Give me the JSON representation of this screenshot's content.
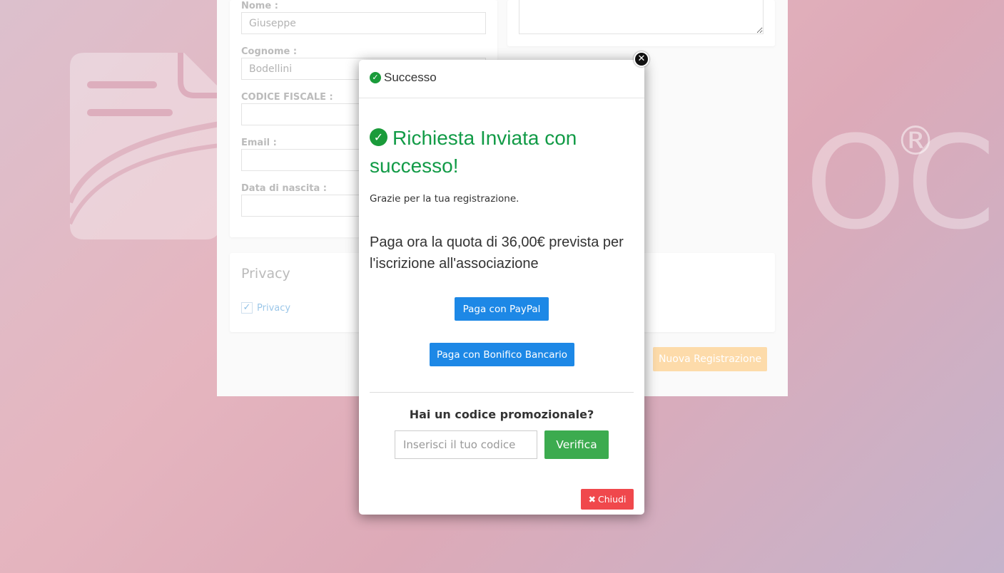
{
  "background": {
    "brand_fragment": "OC",
    "registered_mark": "®"
  },
  "form": {
    "nome_label": "Nome :",
    "nome_value": "Giuseppe",
    "cognome_label": "Cognome :",
    "cognome_value": "Bodellini",
    "codice_label": "CODICE FISCALE :",
    "email_label": "Email :",
    "nascita_label": "Data di nascita :",
    "privacy_title": "Privacy",
    "privacy_checkbox_label": "Privacy",
    "nuova_button": "Nuova Registrazione"
  },
  "modal": {
    "header_title": "Successo",
    "success_title": "Richiesta Inviata con successo!",
    "thanks_text": "Grazie per la tua registrazione.",
    "payment_text": "Paga ora la quota di 36,00€ prevista per l'iscrizione all'associazione",
    "paypal_button": "Paga con PayPal",
    "bonifico_button": "Paga con Bonifico Bancario",
    "promo_question": "Hai un codice promozionale?",
    "promo_placeholder": "Inserisci il tuo codice",
    "verifica_button": "Verifica",
    "chiudi_button": "Chiudi"
  },
  "colors": {
    "success": "#129b47",
    "primary": "#1d88e6",
    "verify": "#3cab4f",
    "danger": "#f0484c"
  }
}
